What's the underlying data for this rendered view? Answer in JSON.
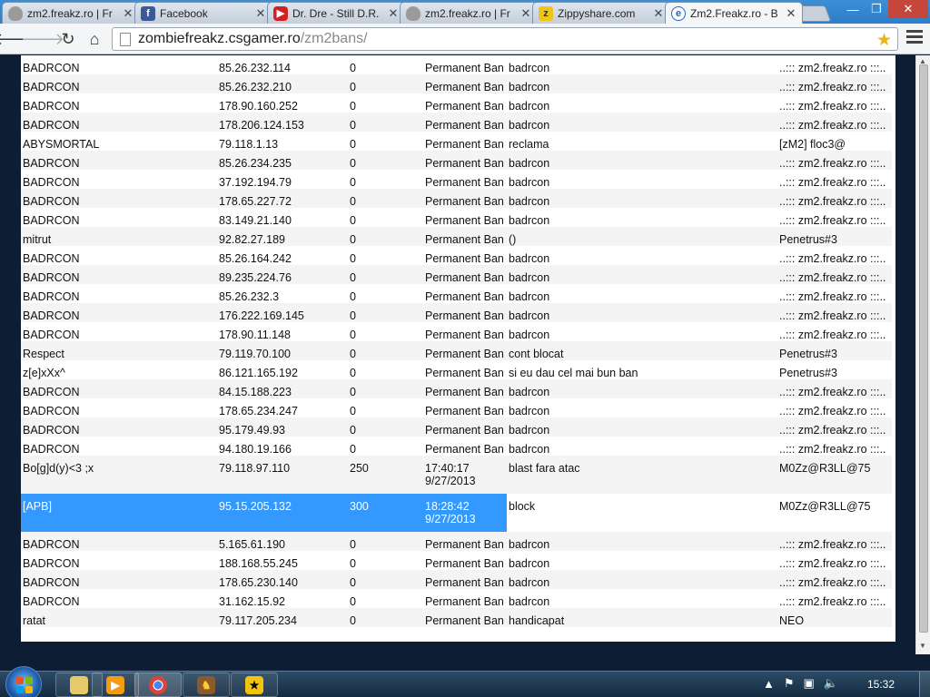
{
  "tabs": [
    {
      "title": "zm2.freakz.ro | Fr",
      "icon": "cat-icon"
    },
    {
      "title": "Facebook",
      "icon": "facebook-icon"
    },
    {
      "title": "Dr. Dre - Still D.R.",
      "icon": "youtube-icon"
    },
    {
      "title": "zm2.freakz.ro | Fr",
      "icon": "cat-icon"
    },
    {
      "title": "Zippyshare.com",
      "icon": "zippyshare-icon"
    },
    {
      "title": "Zm2.Freakz.ro - B",
      "icon": "ie-icon"
    }
  ],
  "window_controls": {
    "minimize": "—",
    "maximize": "❐",
    "close": "✕"
  },
  "address": {
    "host": "zombiefreakz.csgamer.ro",
    "path": "/zm2bans/"
  },
  "bans": [
    [
      "BADRCON",
      "85.26.232.114",
      "0",
      "Permanent Ban",
      "badrcon",
      "..::: zm2.freakz.ro :::.."
    ],
    [
      "BADRCON",
      "85.26.232.210",
      "0",
      "Permanent Ban",
      "badrcon",
      "..::: zm2.freakz.ro :::.."
    ],
    [
      "BADRCON",
      "178.90.160.252",
      "0",
      "Permanent Ban",
      "badrcon",
      "..::: zm2.freakz.ro :::.."
    ],
    [
      "BADRCON",
      "178.206.124.153",
      "0",
      "Permanent Ban",
      "badrcon",
      "..::: zm2.freakz.ro :::.."
    ],
    [
      "ABYSMORTAL",
      "79.118.1.13",
      "0",
      "Permanent Ban",
      "reclama",
      "[zM2] floc3@"
    ],
    [
      "BADRCON",
      "85.26.234.235",
      "0",
      "Permanent Ban",
      "badrcon",
      "..::: zm2.freakz.ro :::.."
    ],
    [
      "BADRCON",
      "37.192.194.79",
      "0",
      "Permanent Ban",
      "badrcon",
      "..::: zm2.freakz.ro :::.."
    ],
    [
      "BADRCON",
      "178.65.227.72",
      "0",
      "Permanent Ban",
      "badrcon",
      "..::: zm2.freakz.ro :::.."
    ],
    [
      "BADRCON",
      "83.149.21.140",
      "0",
      "Permanent Ban",
      "badrcon",
      "..::: zm2.freakz.ro :::.."
    ],
    [
      "mitrut",
      "92.82.27.189",
      "0",
      "Permanent Ban",
      "()",
      "Penetrus#3"
    ],
    [
      "BADRCON",
      "85.26.164.242",
      "0",
      "Permanent Ban",
      "badrcon",
      "..::: zm2.freakz.ro :::.."
    ],
    [
      "BADRCON",
      "89.235.224.76",
      "0",
      "Permanent Ban",
      "badrcon",
      "..::: zm2.freakz.ro :::.."
    ],
    [
      "BADRCON",
      "85.26.232.3",
      "0",
      "Permanent Ban",
      "badrcon",
      "..::: zm2.freakz.ro :::.."
    ],
    [
      "BADRCON",
      "176.222.169.145",
      "0",
      "Permanent Ban",
      "badrcon",
      "..::: zm2.freakz.ro :::.."
    ],
    [
      "BADRCON",
      "178.90.11.148",
      "0",
      "Permanent Ban",
      "badrcon",
      "..::: zm2.freakz.ro :::.."
    ],
    [
      "Respect",
      "79.119.70.100",
      "0",
      "Permanent Ban",
      "cont blocat",
      "Penetrus#3"
    ],
    [
      "z[e]xXx^",
      "86.121.165.192",
      "0",
      "Permanent Ban",
      "si eu dau cel mai bun ban",
      "Penetrus#3"
    ],
    [
      "BADRCON",
      "84.15.188.223",
      "0",
      "Permanent Ban",
      "badrcon",
      "..::: zm2.freakz.ro :::.."
    ],
    [
      "BADRCON",
      "178.65.234.247",
      "0",
      "Permanent Ban",
      "badrcon",
      "..::: zm2.freakz.ro :::.."
    ],
    [
      "BADRCON",
      "95.179.49.93",
      "0",
      "Permanent Ban",
      "badrcon",
      "..::: zm2.freakz.ro :::.."
    ],
    [
      "BADRCON",
      "94.180.19.166",
      "0",
      "Permanent Ban",
      "badrcon",
      "..::: zm2.freakz.ro :::.."
    ],
    [
      "Bo[g]d(y)<3 ;x",
      "79.118.97.110",
      "250",
      "17:40:17 9/27/2013",
      "blast fara atac",
      "M0Zz@R3LL@75"
    ],
    [
      "[APB]",
      "95.15.205.132",
      "300",
      "18:28:42 9/27/2013",
      "block",
      "M0Zz@R3LL@75"
    ],
    [
      "BADRCON",
      "5.165.61.190",
      "0",
      "Permanent Ban",
      "badrcon",
      "..::: zm2.freakz.ro :::.."
    ],
    [
      "BADRCON",
      "188.168.55.245",
      "0",
      "Permanent Ban",
      "badrcon",
      "..::: zm2.freakz.ro :::.."
    ],
    [
      "BADRCON",
      "178.65.230.140",
      "0",
      "Permanent Ban",
      "badrcon",
      "..::: zm2.freakz.ro :::.."
    ],
    [
      "BADRCON",
      "31.162.15.92",
      "0",
      "Permanent Ban",
      "badrcon",
      "..::: zm2.freakz.ro :::.."
    ],
    [
      "ratat",
      "79.117.205.234",
      "0",
      "Permanent Ban",
      "handicapat",
      "NEO"
    ]
  ],
  "selected_row_index": 22,
  "taskbar": {
    "clock": "15:32",
    "apps": [
      "explorer-icon",
      "media-player-icon",
      "chrome-icon",
      "game-icon",
      "app-icon"
    ]
  },
  "colors": {
    "selection": "#3399ff",
    "alt_row": "#f4f4f4",
    "tab_bar": "#2f7ec7"
  }
}
